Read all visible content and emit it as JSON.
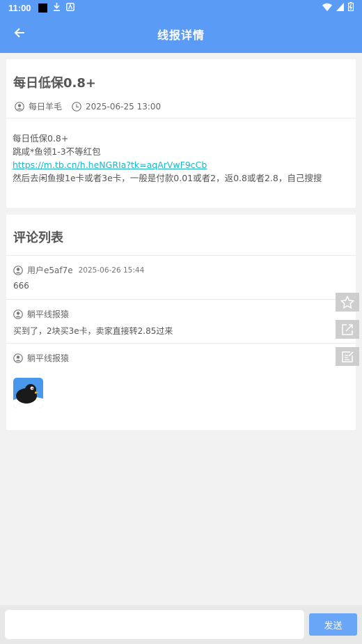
{
  "status_bar": {
    "time": "11:00"
  },
  "app_bar": {
    "title": "线报详情"
  },
  "post": {
    "title": "每日低保0.8+",
    "author": "每日羊毛",
    "datetime": "2025-06-25 13:00",
    "body_lines": [
      "每日低保0.8+",
      "跳咸*鱼领1-3不等红包"
    ],
    "link": "https://m.tb.cn/h.heNGRIa?tk=aqArVwF9cCb",
    "body_last": "然后去闲鱼搜1e卡或者3e卡，一般是付款0.01或者2，返0.8或者2.8，自己搜搜"
  },
  "comments_section": {
    "title": "评论列表",
    "comments": [
      {
        "user": "用户e5af7e",
        "time": "2025-06-26 15:44",
        "text": "666"
      },
      {
        "user": "躺平线报猿",
        "time": "",
        "text": "买到了，2块买3e卡，卖家直接转2.85过来"
      },
      {
        "user": "躺平线报猿",
        "time": "",
        "text": ""
      }
    ]
  },
  "bottom_bar": {
    "input_placeholder": "",
    "send_label": "发送"
  },
  "colors": {
    "primary": "#5a9cf5",
    "link": "#1ab6c8",
    "send": "#6aa6f8"
  }
}
